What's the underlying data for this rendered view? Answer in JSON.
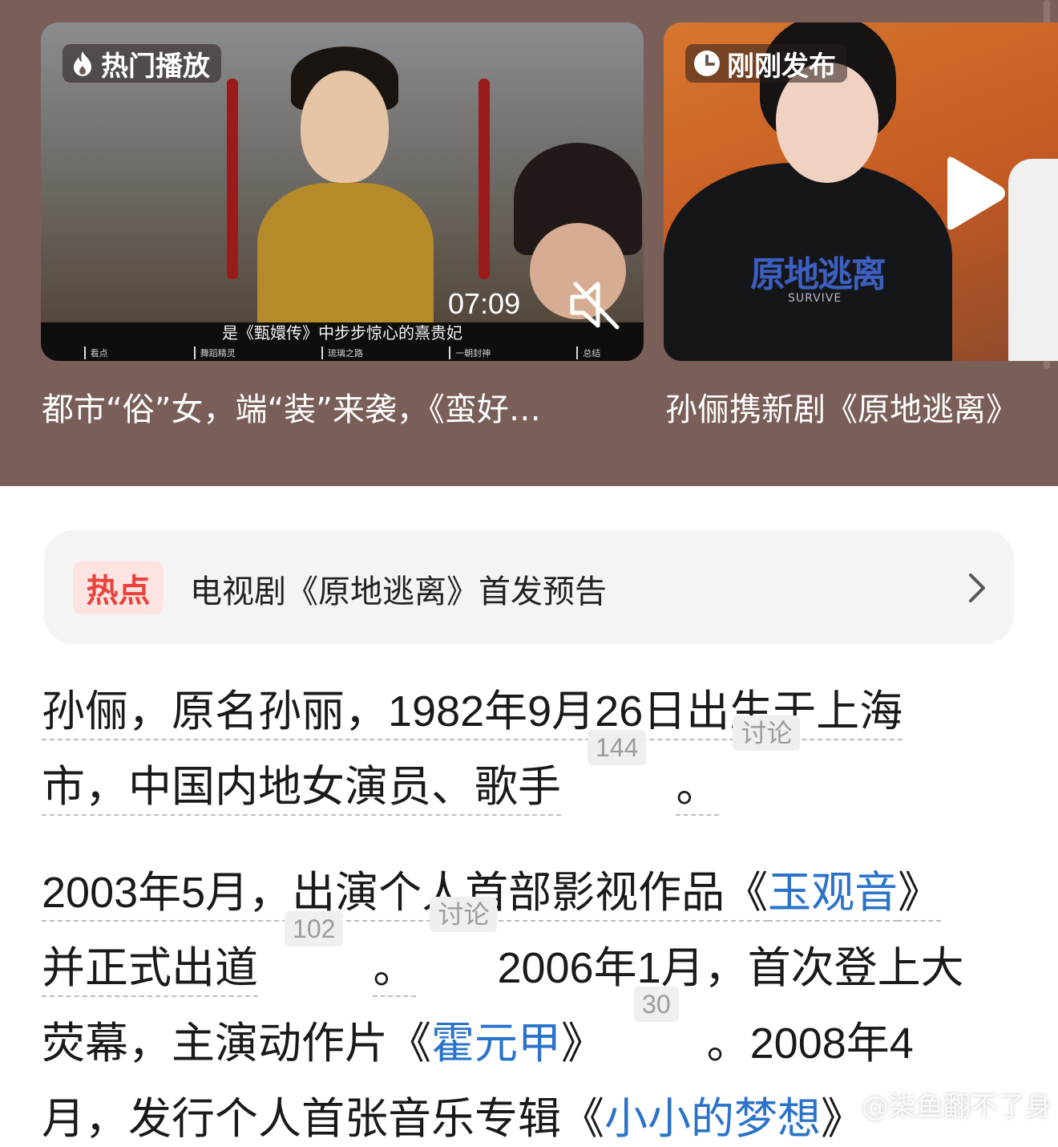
{
  "feed": {
    "cards": [
      {
        "badge": "热门播放",
        "badge_icon": "flame-icon",
        "duration": "07:09",
        "subtitle": "是《甄嬛传》中步步惊心的熹贵妃",
        "chapters": [
          "看点",
          "舞蹈精灵",
          "琉璃之路",
          "一朝封神",
          "总结"
        ],
        "title": "都市“俗”女，端“装”来袭，《蛮好…"
      },
      {
        "badge": "刚刚发布",
        "badge_icon": "clock-icon",
        "shirt_title": "原地逃离",
        "shirt_sub": "SURVIVE",
        "title": "孙俪携新剧《原地逃离》"
      }
    ]
  },
  "hot": {
    "tag": "热点",
    "text": "电视剧《原地逃离》首发预告"
  },
  "article": {
    "p1": {
      "l1": "孙俪，原名孙丽，1982年9月26日出生于上海",
      "l2a": "市，中国内地女演员、歌手",
      "ref1": "144",
      "l2b": "。",
      "tag1": "讨论"
    },
    "p2": {
      "l1a": "2003年5月，出演个人首部影视作品《",
      "l1link": "玉观音",
      "l1b": "》",
      "l2a": "并正式出道",
      "ref2": "102",
      "l2b": "。",
      "tag2": "讨论",
      "l2c": "2006年1月，首次登上大",
      "l3a": "荧幕，主演动作片《",
      "l3link": "霍元甲",
      "l3b": "》",
      "ref3": "30",
      "l3c": "。2008年4",
      "l4a": "月，发行个人首张音乐专辑《",
      "l4link": "小小的梦想",
      "l4b": "》"
    }
  },
  "watermark": "@柒鱼翻不了身",
  "colors": {
    "panel_bg": "#7a5f59",
    "link": "#2a73c9",
    "hot_red": "#e8423a"
  }
}
